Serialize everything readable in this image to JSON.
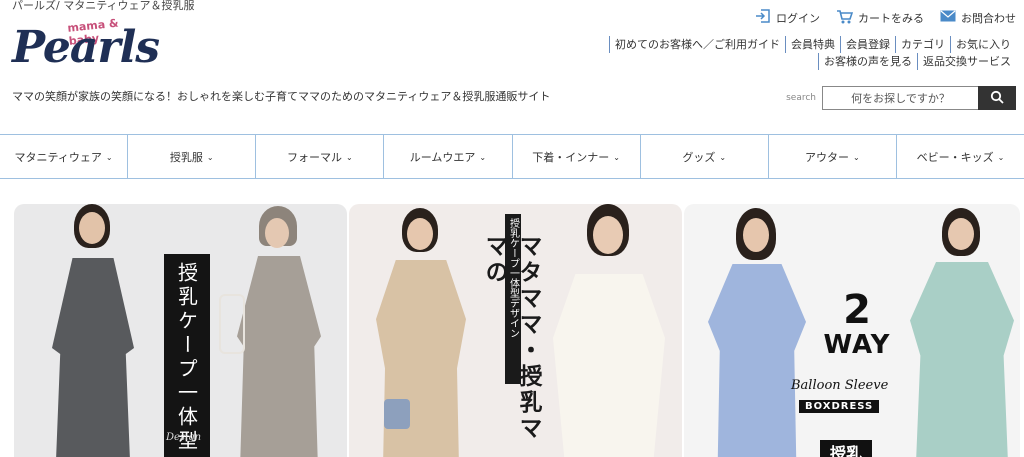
{
  "breadcrumb": "パールズ/ マタニティウェア＆授乳服",
  "logo": {
    "brand": "Pearls",
    "sub": "mama & baby"
  },
  "tagline": "ママの笑顔が家族の笑顔になる！おしゃれを楽しむ子育てママのためのマタニティウェア＆授乳服通販サイト",
  "top_links": [
    {
      "label": "ログイン",
      "icon": "login-icon"
    },
    {
      "label": "カートをみる",
      "icon": "cart-icon"
    },
    {
      "label": "お問合わせ",
      "icon": "mail-icon"
    }
  ],
  "info_links": {
    "row1": [
      "初めてのお客様へ／ご利用ガイド",
      "会員特典",
      "会員登録",
      "カテゴリ",
      "お気に入り"
    ],
    "row2": [
      "お客様の声を見る",
      "返品交換サービス"
    ]
  },
  "search": {
    "label": "search",
    "placeholder": "何をお探しですか？"
  },
  "nav": [
    "マタニティウェア",
    "授乳服",
    "フォーマル",
    "ルームウエア",
    "下着・インナー",
    "グッズ",
    "アウター",
    "ベビー・キッズ"
  ],
  "banners": {
    "b1": {
      "vertical": "授乳ケープ一体型",
      "script": "Design"
    },
    "b2": {
      "tag": "授乳ケープ一体型デザイン",
      "main": "マタママ・授乳ママの"
    },
    "b3": {
      "two": "2",
      "way": "WAY",
      "balloon": "Balloon Sleeve",
      "boxdress": "BOXDRESS",
      "jyu": "授乳"
    }
  },
  "colors": {
    "brand": "#1f2f55",
    "accent_pink": "#c7507a",
    "icon_blue": "#4a8ac8",
    "nav_border": "#9ec0e0"
  }
}
